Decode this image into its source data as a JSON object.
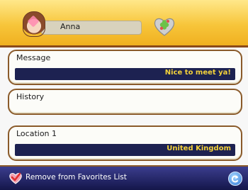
{
  "header": {
    "username": "Anna",
    "friend_icon": "friend-heart-clover-icon"
  },
  "panels": {
    "message": {
      "title": "Message",
      "value": "Nice to meet ya!"
    },
    "history": {
      "title": "History"
    },
    "location": {
      "title": "Location 1",
      "value": "United Kingdom"
    }
  },
  "footer": {
    "remove_label": "Remove from Favorites List",
    "remove_icon": "heart-check-icon",
    "back_icon": "back-arrow-icon"
  },
  "colors": {
    "header_gold": "#f7c53a",
    "panel_border": "#8a5a2a",
    "value_bar": "#1d2251",
    "value_text": "#f4d23a",
    "footer_bg": "#14164a",
    "back_blue": "#2f78d8"
  }
}
